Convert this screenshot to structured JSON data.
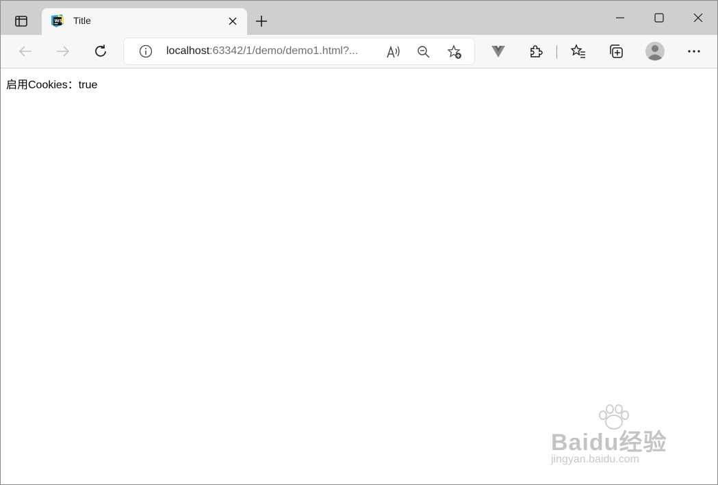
{
  "tab": {
    "title": "Title",
    "favicon_text": "WS"
  },
  "address": {
    "host": "localhost",
    "path": ":63342/1/demo/demo1.html?..."
  },
  "page": {
    "text": "启用Cookies：true"
  },
  "watermark": {
    "brand": "Baidu经验",
    "sub": "jingyan.baidu.com"
  },
  "colors": {
    "tabstrip": "#cfcfcf",
    "toolbar": "#f7f7f7",
    "favicon_bg": "#1b2b4f",
    "favicon_accent": "#27a8e0"
  }
}
